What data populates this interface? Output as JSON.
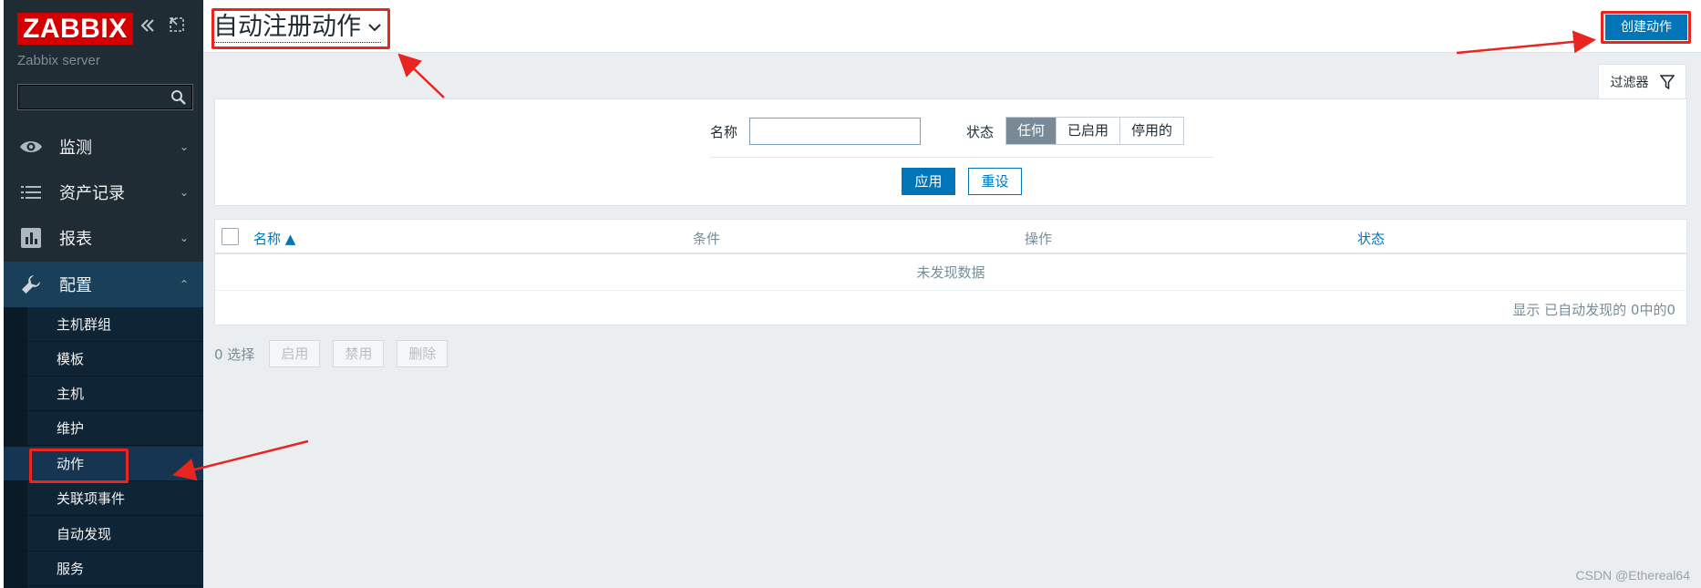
{
  "sidebar": {
    "logo": "ZABBIX",
    "collapse_icon": "double-chevron-left-icon",
    "expand_icon": "popout-icon",
    "server_name": "Zabbix server",
    "search_placeholder": "",
    "menu": [
      {
        "label": "监测",
        "icon": "eye-icon"
      },
      {
        "label": "资产记录",
        "icon": "list-icon"
      },
      {
        "label": "报表",
        "icon": "chart-icon"
      },
      {
        "label": "配置",
        "icon": "wrench-icon"
      }
    ],
    "submenu": [
      {
        "label": "主机群组"
      },
      {
        "label": "模板"
      },
      {
        "label": "主机"
      },
      {
        "label": "维护"
      },
      {
        "label": "动作"
      },
      {
        "label": "关联项事件"
      },
      {
        "label": "自动发现"
      },
      {
        "label": "服务"
      }
    ]
  },
  "header": {
    "title": "自动注册动作",
    "create_button": "创建动作"
  },
  "filter": {
    "tab_label": "过滤器",
    "name_label": "名称",
    "name_value": "",
    "status_label": "状态",
    "status_options": [
      "任何",
      "已启用",
      "停用的"
    ],
    "status_selected": "任何",
    "apply": "应用",
    "reset": "重设"
  },
  "table": {
    "columns": [
      "名称 ▲",
      "条件",
      "操作",
      "状态"
    ],
    "empty_text": "未发现数据",
    "paging_text": "显示 已自动发现的 0中的0"
  },
  "actions": {
    "selected_count": "0 选择",
    "buttons": [
      "启用",
      "禁用",
      "删除"
    ]
  },
  "watermark": "CSDN @Ethereal64",
  "colors": {
    "sidebar_bg": "#1f2c33",
    "accent": "#0275b8",
    "annotation": "#e8251f"
  }
}
